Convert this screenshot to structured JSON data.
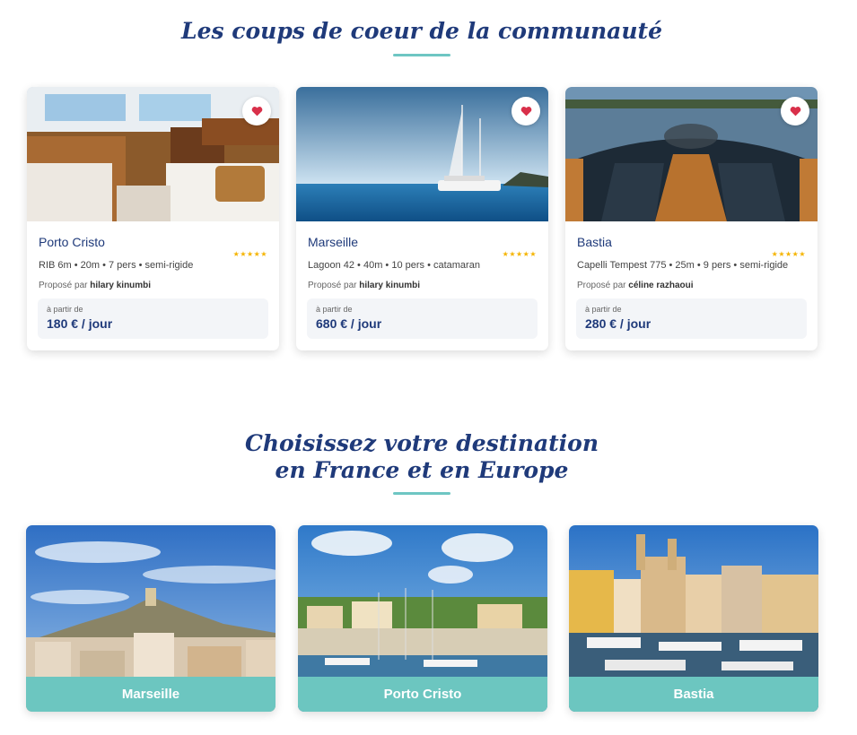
{
  "favorites": {
    "title": "Les coups de coeur de la communauté",
    "cards": [
      {
        "name": "Porto Cristo",
        "rating": "★★★★★",
        "specs": "RIB 6m • 20m • 7 pers • semi-rigide",
        "owner_prefix": "Proposé par",
        "owner": "hilary kinumbi",
        "price_from": "à partir de",
        "price": "180 € / jour"
      },
      {
        "name": "Marseille",
        "rating": "★★★★★",
        "specs": "Lagoon 42 • 40m • 10 pers • catamaran",
        "owner_prefix": "Proposé par",
        "owner": "hilary kinumbi",
        "price_from": "à partir de",
        "price": "680 € / jour"
      },
      {
        "name": "Bastia",
        "rating": "★★★★★",
        "specs": "Capelli Tempest 775 • 25m • 9 pers • semi-rigide",
        "owner_prefix": "Proposé par",
        "owner": "céline razhaoui",
        "price_from": "à partir de",
        "price": "280 € / jour"
      }
    ]
  },
  "destinations": {
    "title_line1": "Choisissez votre destination",
    "title_line2": "en France et en Europe",
    "items": [
      {
        "label": "Marseille"
      },
      {
        "label": "Porto Cristo"
      },
      {
        "label": "Bastia"
      }
    ]
  },
  "colors": {
    "accent": "#6cc6c0",
    "brand": "#1f3a7a",
    "heart": "#d9304a",
    "star": "#f5b400"
  },
  "icons": {
    "favorite": "heart-icon",
    "rating": "star-icon"
  }
}
